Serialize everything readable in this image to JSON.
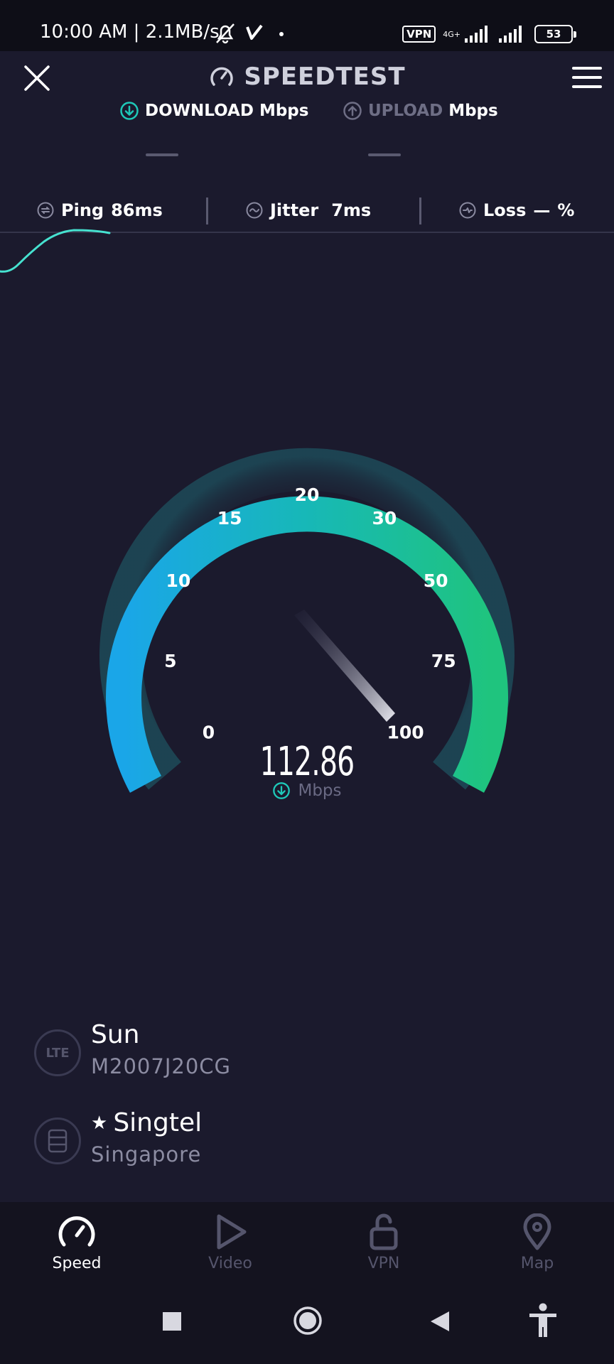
{
  "status_bar": {
    "time_text": "10:00 AM | 2.1MB/s",
    "vpn_badge": "VPN",
    "network_type": "4G+",
    "battery_level": "53"
  },
  "header": {
    "title": "SPEEDTEST"
  },
  "tabs": {
    "download_label": "DOWNLOAD",
    "download_unit": "Mbps",
    "upload_label": "UPLOAD",
    "upload_unit": "Mbps"
  },
  "stats": {
    "ping_label": "Ping",
    "ping_value": "86ms",
    "jitter_label": "Jitter",
    "jitter_value": "7ms",
    "loss_label": "Loss",
    "loss_value": "—",
    "loss_unit": "%"
  },
  "gauge": {
    "ticks": [
      "0",
      "5",
      "10",
      "15",
      "20",
      "30",
      "50",
      "75",
      "100"
    ],
    "speed_value": "112.86",
    "speed_unit": "Mbps",
    "needle_level": "100+",
    "colors": {
      "start": "#1aa6e8",
      "end": "#1fc47e"
    }
  },
  "connection": {
    "carrier_badge": "LTE",
    "carrier_name": "Sun",
    "device_model": "M2007J20CG",
    "server_name": "Singtel",
    "server_location": "Singapore"
  },
  "bottom_nav": {
    "speed": "Speed",
    "video": "Video",
    "vpn": "VPN",
    "map": "Map"
  },
  "colors": {
    "background": "#1b1a2d",
    "accent": "#1ec8b8"
  }
}
